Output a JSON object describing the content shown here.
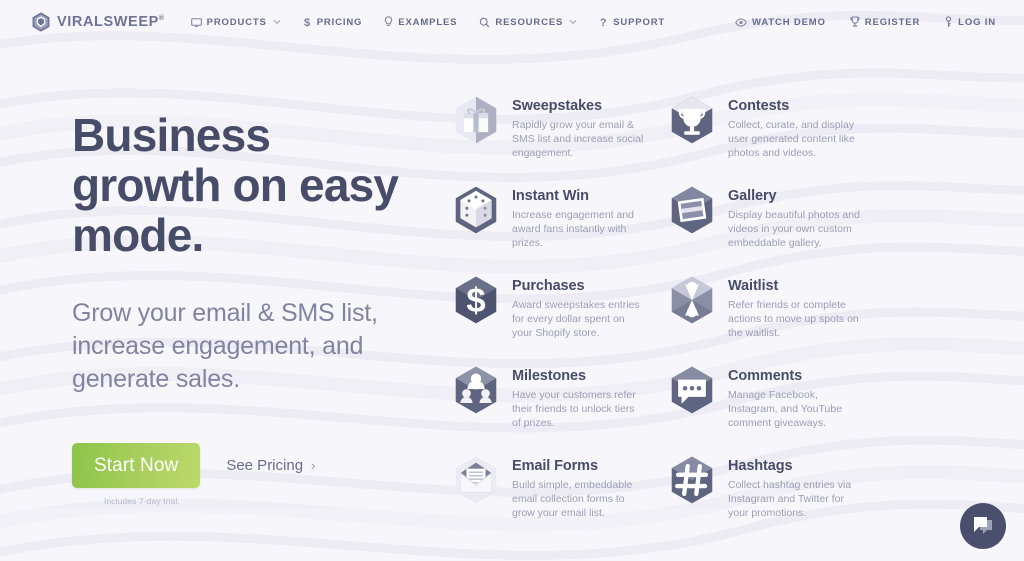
{
  "brand": {
    "logo_text": "VIRALSWEEP",
    "registered_mark": "®",
    "logo_icon": "viralsweep-hexagon-logo",
    "accent_green_start": "#8cc44a",
    "accent_green_end": "#bcd96b",
    "ink": "#474c68",
    "muted": "#9a9eb4",
    "page_background": "#f7f7fb"
  },
  "header": {
    "nav_main": [
      {
        "label": "PRODUCTS",
        "icon": "monitor-icon",
        "has_caret": true
      },
      {
        "label": "PRICING",
        "icon": "dollar-icon",
        "has_caret": false
      },
      {
        "label": "EXAMPLES",
        "icon": "lightbulb-icon",
        "has_caret": false
      },
      {
        "label": "RESOURCES",
        "icon": "search-icon",
        "has_caret": true
      },
      {
        "label": "SUPPORT",
        "icon": "question-mark-icon",
        "has_caret": false
      }
    ],
    "nav_right": [
      {
        "label": "WATCH DEMO",
        "icon": "eye-icon"
      },
      {
        "label": "REGISTER",
        "icon": "trophy-icon"
      },
      {
        "label": "LOG IN",
        "icon": "key-icon"
      }
    ]
  },
  "hero": {
    "headline": "Business growth on easy mode.",
    "subheadline": "Grow your email & SMS list, increase engagement, and generate sales.",
    "primary_cta": "Start Now",
    "secondary_cta": "See Pricing",
    "secondary_cta_chevron": "›",
    "trial_note": "Includes 7-day trial."
  },
  "features": [
    {
      "title": "Sweepstakes",
      "description": "Rapidly grow your email & SMS list and increase social engagement.",
      "icon": "gift-box-hexagon-icon"
    },
    {
      "title": "Contests",
      "description": "Collect, curate, and display user generated content like photos and videos.",
      "icon": "trophy-hexagon-icon"
    },
    {
      "title": "Instant Win",
      "description": "Increase engagement and award fans instantly with prizes.",
      "icon": "dice-hexagon-icon"
    },
    {
      "title": "Gallery",
      "description": "Display beautiful photos and videos in your own custom embeddable gallery.",
      "icon": "photo-hexagon-icon"
    },
    {
      "title": "Purchases",
      "description": "Award sweepstakes entries for every dollar spent on your Shopify store.",
      "icon": "dollar-sign-hexagon-icon"
    },
    {
      "title": "Waitlist",
      "description": "Refer friends or complete actions to move up spots on the waitlist.",
      "icon": "hourglass-hexagon-icon"
    },
    {
      "title": "Milestones",
      "description": "Have your customers refer their friends to unlock tiers of prizes.",
      "icon": "people-tiers-hexagon-icon"
    },
    {
      "title": "Comments",
      "description": "Manage Facebook, Instagram, and YouTube comment giveaways.",
      "icon": "speech-bubble-hexagon-icon"
    },
    {
      "title": "Email Forms",
      "description": "Build simple, embeddable email collection forms to grow your email list.",
      "icon": "envelope-hexagon-icon"
    },
    {
      "title": "Hashtags",
      "description": "Collect hashtag entries via Instagram and Twitter for your promotions.",
      "icon": "hashtag-hexagon-icon"
    }
  ],
  "chat_widget": {
    "icon": "chat-bubble-icon",
    "label": "Open chat"
  }
}
